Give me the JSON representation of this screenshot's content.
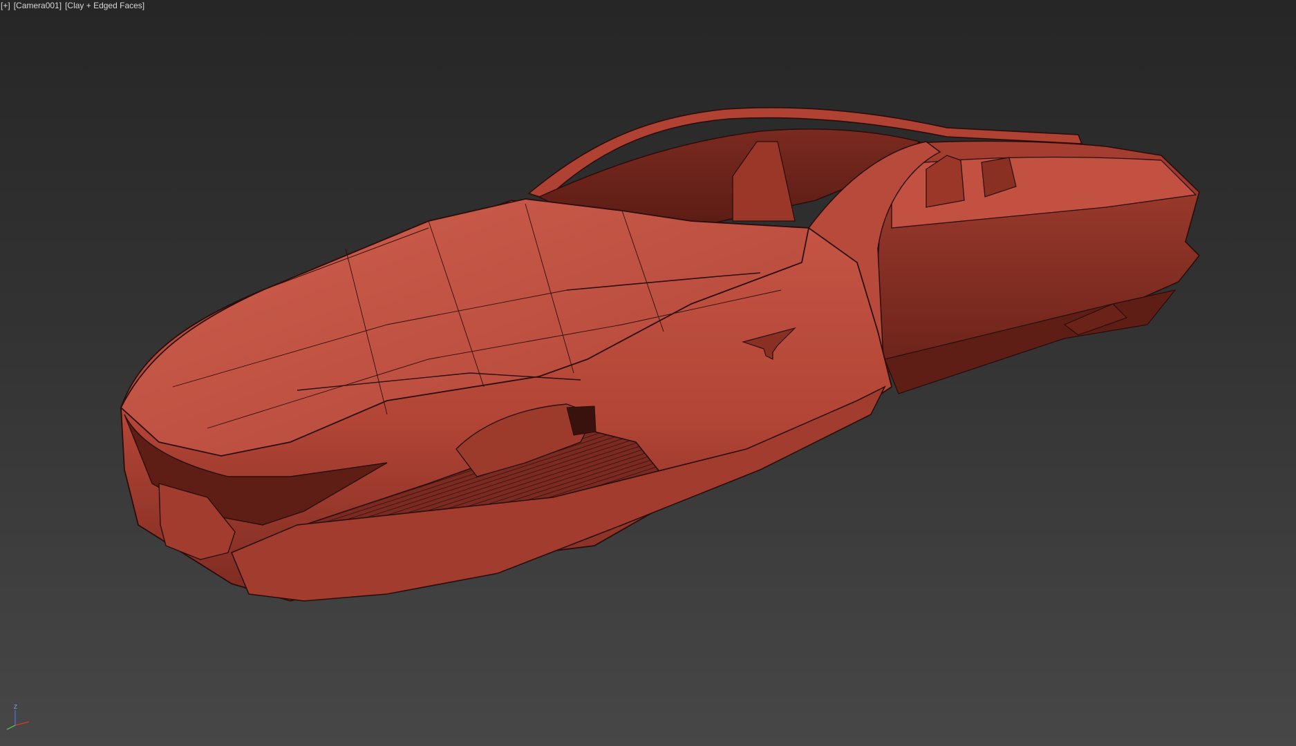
{
  "viewport": {
    "label": {
      "plus_menu": "[+]",
      "camera": "[Camera001]",
      "shading": "[Clay + Edged Faces]"
    },
    "background_top": "#262626",
    "background_bottom": "#474747"
  },
  "model": {
    "name": "hover car",
    "clay_color": "#b84a3c",
    "edge_color": "#2a0d0a",
    "shadow_color": "#6e231b",
    "highlight_color": "#d5685a"
  },
  "axis_gizmo": {
    "z_label": "Z",
    "x_color": "#d83a2c",
    "y_color": "#4fc04a",
    "z_color": "#4a6ee0"
  }
}
